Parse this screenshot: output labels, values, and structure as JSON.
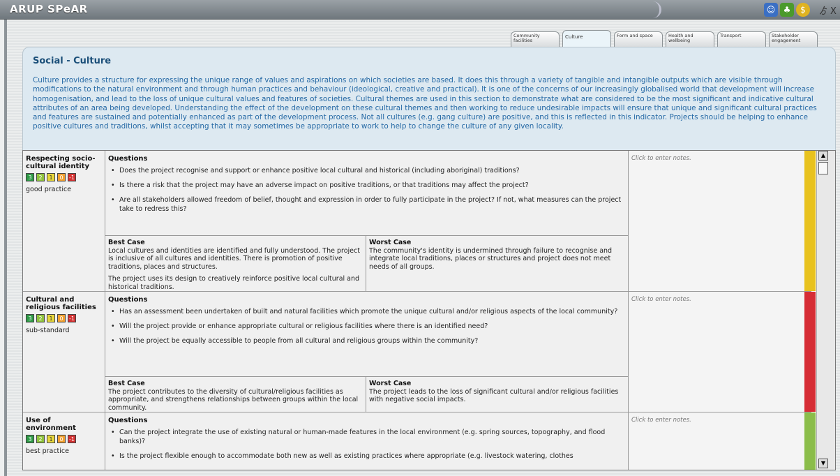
{
  "app_title": "ARUP SPeAR",
  "window_controls": "ゟX",
  "icons": [
    "people-icon",
    "tree-icon",
    "dollar-icon"
  ],
  "tabs": [
    {
      "label": "Community facilities"
    },
    {
      "label": "Culture",
      "active": true
    },
    {
      "label": "Form and space"
    },
    {
      "label": "Health and wellbeing"
    },
    {
      "label": "Transport"
    },
    {
      "label": "Stakeholder engagement"
    }
  ],
  "section": {
    "title": "Social - Culture",
    "description": "Culture provides a structure for expressing the unique range of values and aspirations on which societies are based. It does this through a variety of tangible and intangible outputs which are visible through modifications to the natural environment and through human practices and behaviour (ideological, creative and practical). It is one of the concerns of our increasingly globalised world that development will increase homogenisation, and lead to the loss of unique cultural values and features of societies. Cultural themes are used in this section to demonstrate what are considered to be the most significant and indicative cultural attributes of an area being developed. Understanding the effect of the development on these cultural themes and then working to reduce undesirable impacts will ensure that unique and significant cultural practices and features are sustained and potentially enhanced as part of the development process. Not all cultures (e.g. gang culture) are positive, and this is reflected in this indicator. Projects should be helping to enhance positive cultures and traditions, whilst accepting that it may sometimes be appropriate to work to help to change the culture of any given locality."
  },
  "score_labels": [
    "3",
    "2",
    "1",
    "0",
    "-1"
  ],
  "questions_heading": "Questions",
  "best_case_heading": "Best Case",
  "worst_case_heading": "Worst Case",
  "notes_placeholder": "Click to enter notes.",
  "indicators": [
    {
      "title": "Respecting socio-cultural identity",
      "rating": "good practice",
      "status_color": "#e8c21e",
      "questions": [
        "Does the project recognise and support or enhance positive local cultural and historical (including aboriginal) traditions?",
        "Is there a risk that the project may have an adverse impact on positive traditions, or that traditions may affect the project?",
        "Are all stakeholders allowed freedom of belief, thought and expression in order to fully participate in the project? If not, what measures can the project take to redress this?"
      ],
      "best_case": "Local cultures and identities are identified and fully understood. The project is inclusive of all cultures and identities. There is promotion of positive traditions, places and structures.",
      "best_case_2": "The project uses its design to creatively reinforce positive local cultural and historical traditions.",
      "worst_case": "The community's identity is undermined through failure to recognise and integrate local traditions, places or structures and project does not meet needs of all groups."
    },
    {
      "title": "Cultural and religious facilities",
      "rating": "sub-standard",
      "status_color": "#d62d35",
      "questions": [
        "Has an assessment been undertaken of built and natural facilities which promote the unique cultural and/or religious aspects of the local community?",
        "Will the project provide or enhance appropriate cultural or religious facilities where there is an identified need?",
        "Will the project be equally accessible to people from all cultural and religious groups within the community?"
      ],
      "best_case": "The project contributes to the diversity of cultural/religious facilities as appropriate, and strengthens relationships between groups within the local community.",
      "worst_case": "The project leads to the loss of significant cultural and/or religious facilities with negative social impacts."
    },
    {
      "title": "Use of environment",
      "rating": "best practice",
      "status_color": "#8bbd4a",
      "questions": [
        "Can the project integrate the use of existing natural or human-made features in the local environment (e.g. spring sources, topography, and flood banks)?",
        "Is the project flexible enough to accommodate both new as well as existing practices where appropriate (e.g. livestock watering, clothes"
      ]
    }
  ]
}
